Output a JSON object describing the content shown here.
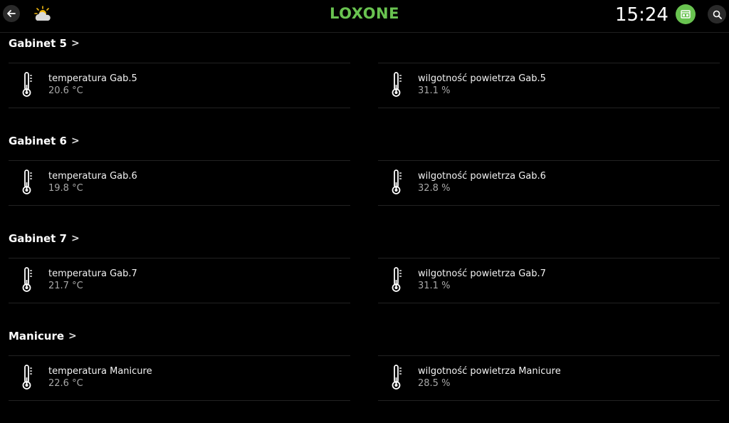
{
  "header": {
    "brand": "LOXONE",
    "time": "15:24",
    "brand_color": "#69c350",
    "status_color": "#69c350"
  },
  "sections": [
    {
      "title": "Gabinet 5",
      "left": {
        "label": "temperatura Gab.5",
        "value": "20.6 °C"
      },
      "right": {
        "label": "wilgotność powietrza Gab.5",
        "value": "31.1 %"
      }
    },
    {
      "title": "Gabinet 6",
      "left": {
        "label": "temperatura Gab.6",
        "value": "19.8 °C"
      },
      "right": {
        "label": "wilgotność powietrza Gab.6",
        "value": "32.8 %"
      }
    },
    {
      "title": "Gabinet 7",
      "left": {
        "label": "temperatura Gab.7",
        "value": "21.7 °C"
      },
      "right": {
        "label": "wilgotność powietrza Gab.7",
        "value": "31.1 %"
      }
    },
    {
      "title": "Manicure",
      "left": {
        "label": "temperatura Manicure",
        "value": "22.6 °C"
      },
      "right": {
        "label": "wilgotność powietrza Manicure",
        "value": "28.5 %"
      }
    }
  ]
}
